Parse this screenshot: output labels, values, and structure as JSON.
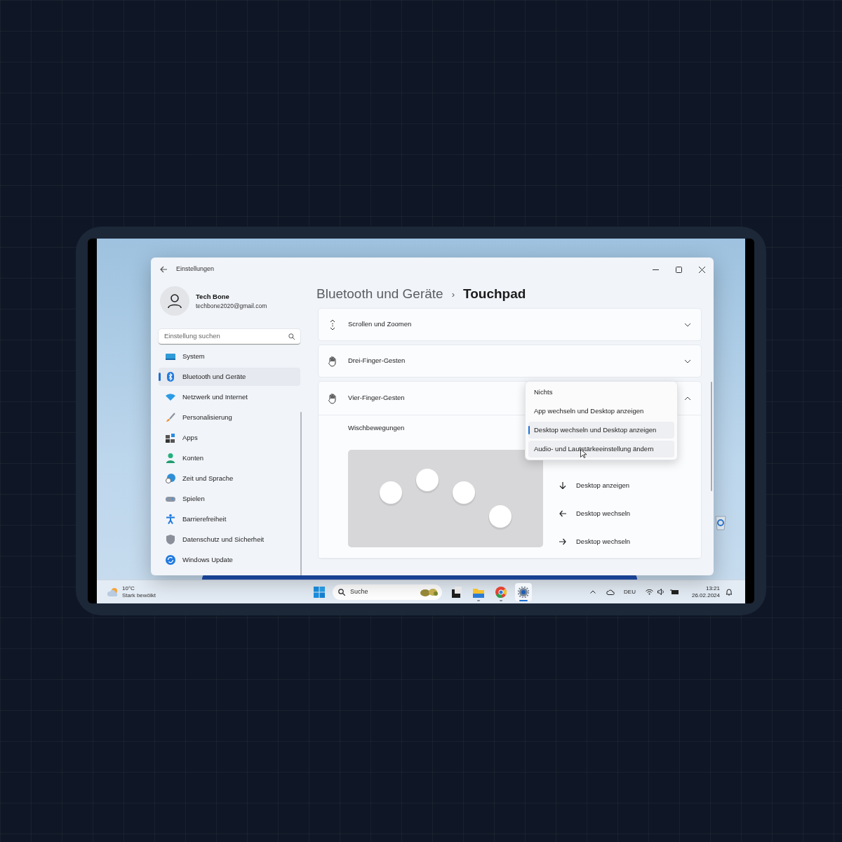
{
  "window": {
    "title": "Einstellungen"
  },
  "account": {
    "name": "Tech Bone",
    "email": "techbone2020@gmail.com"
  },
  "search": {
    "placeholder": "Einstellung suchen"
  },
  "nav": [
    {
      "label": "System",
      "kind": "system",
      "selected": false
    },
    {
      "label": "Bluetooth und Geräte",
      "kind": "bluetooth",
      "selected": true
    },
    {
      "label": "Netzwerk und Internet",
      "kind": "network",
      "selected": false
    },
    {
      "label": "Personalisierung",
      "kind": "brush",
      "selected": false
    },
    {
      "label": "Apps",
      "kind": "apps",
      "selected": false
    },
    {
      "label": "Konten",
      "kind": "accounts",
      "selected": false
    },
    {
      "label": "Zeit und Sprache",
      "kind": "time",
      "selected": false
    },
    {
      "label": "Spielen",
      "kind": "gaming",
      "selected": false
    },
    {
      "label": "Barrierefreiheit",
      "kind": "accessibility",
      "selected": false
    },
    {
      "label": "Datenschutz und Sicherheit",
      "kind": "privacy",
      "selected": false
    },
    {
      "label": "Windows Update",
      "kind": "update",
      "selected": false
    }
  ],
  "breadcrumb": {
    "parent": "Bluetooth und Geräte",
    "separator": "›",
    "current": "Touchpad"
  },
  "sections": [
    {
      "label": "Scrollen und Zoomen",
      "kind": "scroll",
      "expanded": false
    },
    {
      "label": "Drei-Finger-Gesten",
      "kind": "hand",
      "expanded": false
    },
    {
      "label": "Vier-Finger-Gesten",
      "kind": "hand",
      "expanded": true
    }
  ],
  "swipes": {
    "label": "Wischbewegungen",
    "directions": [
      {
        "kind": "down",
        "label": "Desktop anzeigen"
      },
      {
        "kind": "left",
        "label": "Desktop wechseln"
      },
      {
        "kind": "right",
        "label": "Desktop wechseln"
      }
    ]
  },
  "dropdown": {
    "options": [
      {
        "label": "Nichts",
        "selected": false,
        "hovered": false
      },
      {
        "label": "App wechseln und Desktop anzeigen",
        "selected": false,
        "hovered": false
      },
      {
        "label": "Desktop wechseln und Desktop anzeigen",
        "selected": true,
        "hovered": false
      },
      {
        "label": "Audio- und Lautstärkeeinstellung ändern",
        "selected": false,
        "hovered": true
      }
    ]
  },
  "taskbar": {
    "weather": {
      "temperature": "10°C",
      "condition": "Stark bewölkt"
    },
    "search": {
      "placeholder": "Suche"
    },
    "apps": [
      {
        "kind": "terminal",
        "running": false,
        "active": false
      },
      {
        "kind": "files",
        "running": true,
        "active": false
      },
      {
        "kind": "browser",
        "running": true,
        "active": false
      },
      {
        "kind": "settings",
        "running": true,
        "active": true
      }
    ],
    "language": "DEU",
    "time": "13:21",
    "date": "26.02.2024"
  }
}
